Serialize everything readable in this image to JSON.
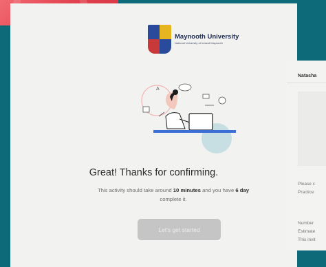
{
  "university": {
    "name": "Maynooth University",
    "subtitle": "National University of Ireland Maynooth"
  },
  "confirmation": {
    "headline": "Great! Thanks for confirming.",
    "body_part1": "This activity should take around ",
    "duration": "10 minutes",
    "body_part2": " and you have ",
    "days": "6 day",
    "body_part3": "complete it."
  },
  "start_button": {
    "label": "Let's get started"
  },
  "side_panel": {
    "name": "Natasha",
    "lines": [
      "Please c",
      "Practice",
      "Number",
      "Estimate",
      "This invit"
    ]
  }
}
